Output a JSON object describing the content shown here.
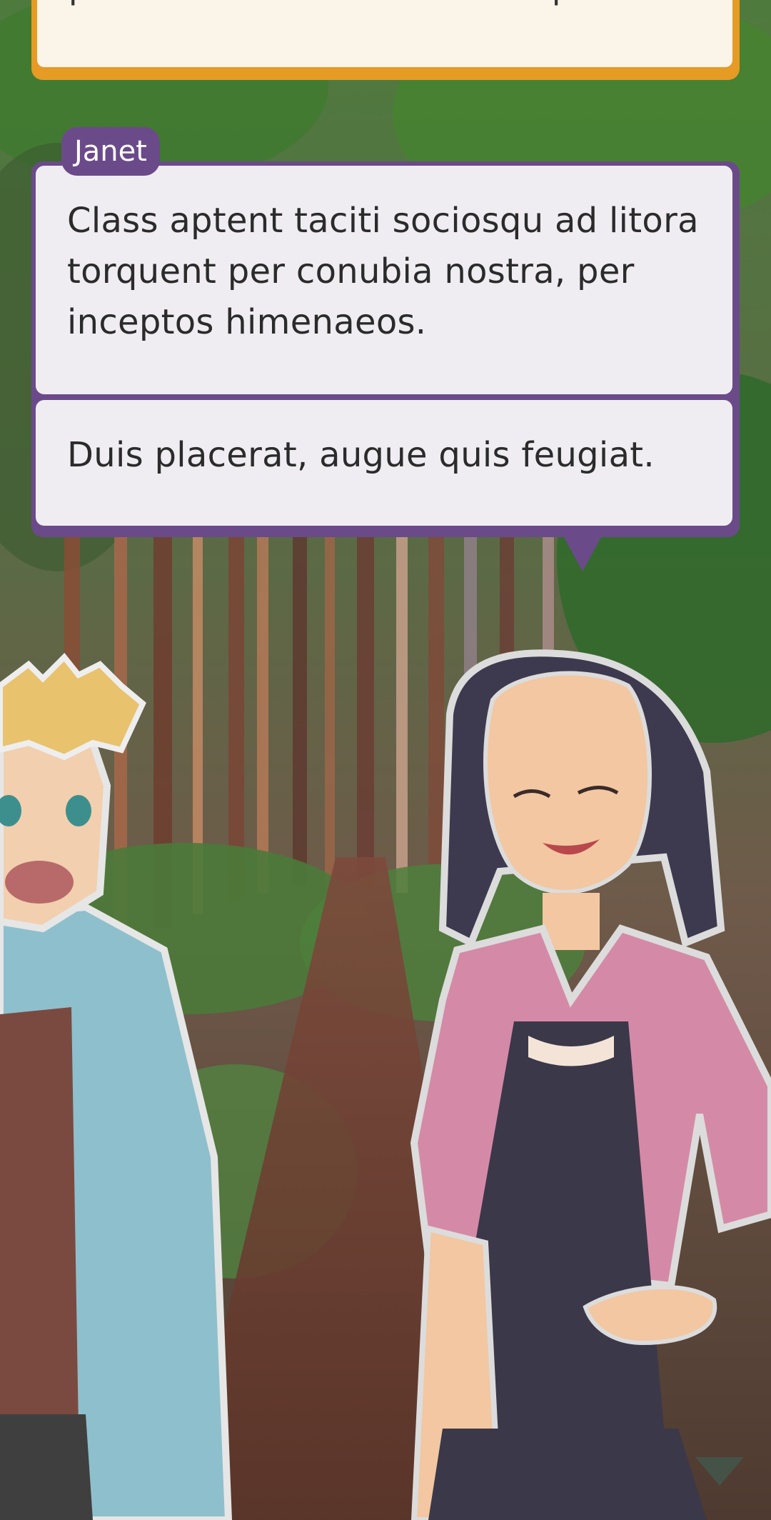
{
  "dialogue": {
    "previous_line": "purus et dui vestibulum suscipit.",
    "speaker": "Janet",
    "lines": [
      "Class aptent taciti sociosqu ad litora torquent per conubia nostra, per inceptos himenaeos.",
      "Duis placerat, augue quis feugiat."
    ]
  },
  "colors": {
    "previous_bubble_border": "#e59b24",
    "previous_bubble_fill": "#fbf4e9",
    "speaker_accent": "#6b4a8a",
    "dialogue_fill": "#efedf2"
  },
  "icons": [
    "next-arrow-icon"
  ]
}
